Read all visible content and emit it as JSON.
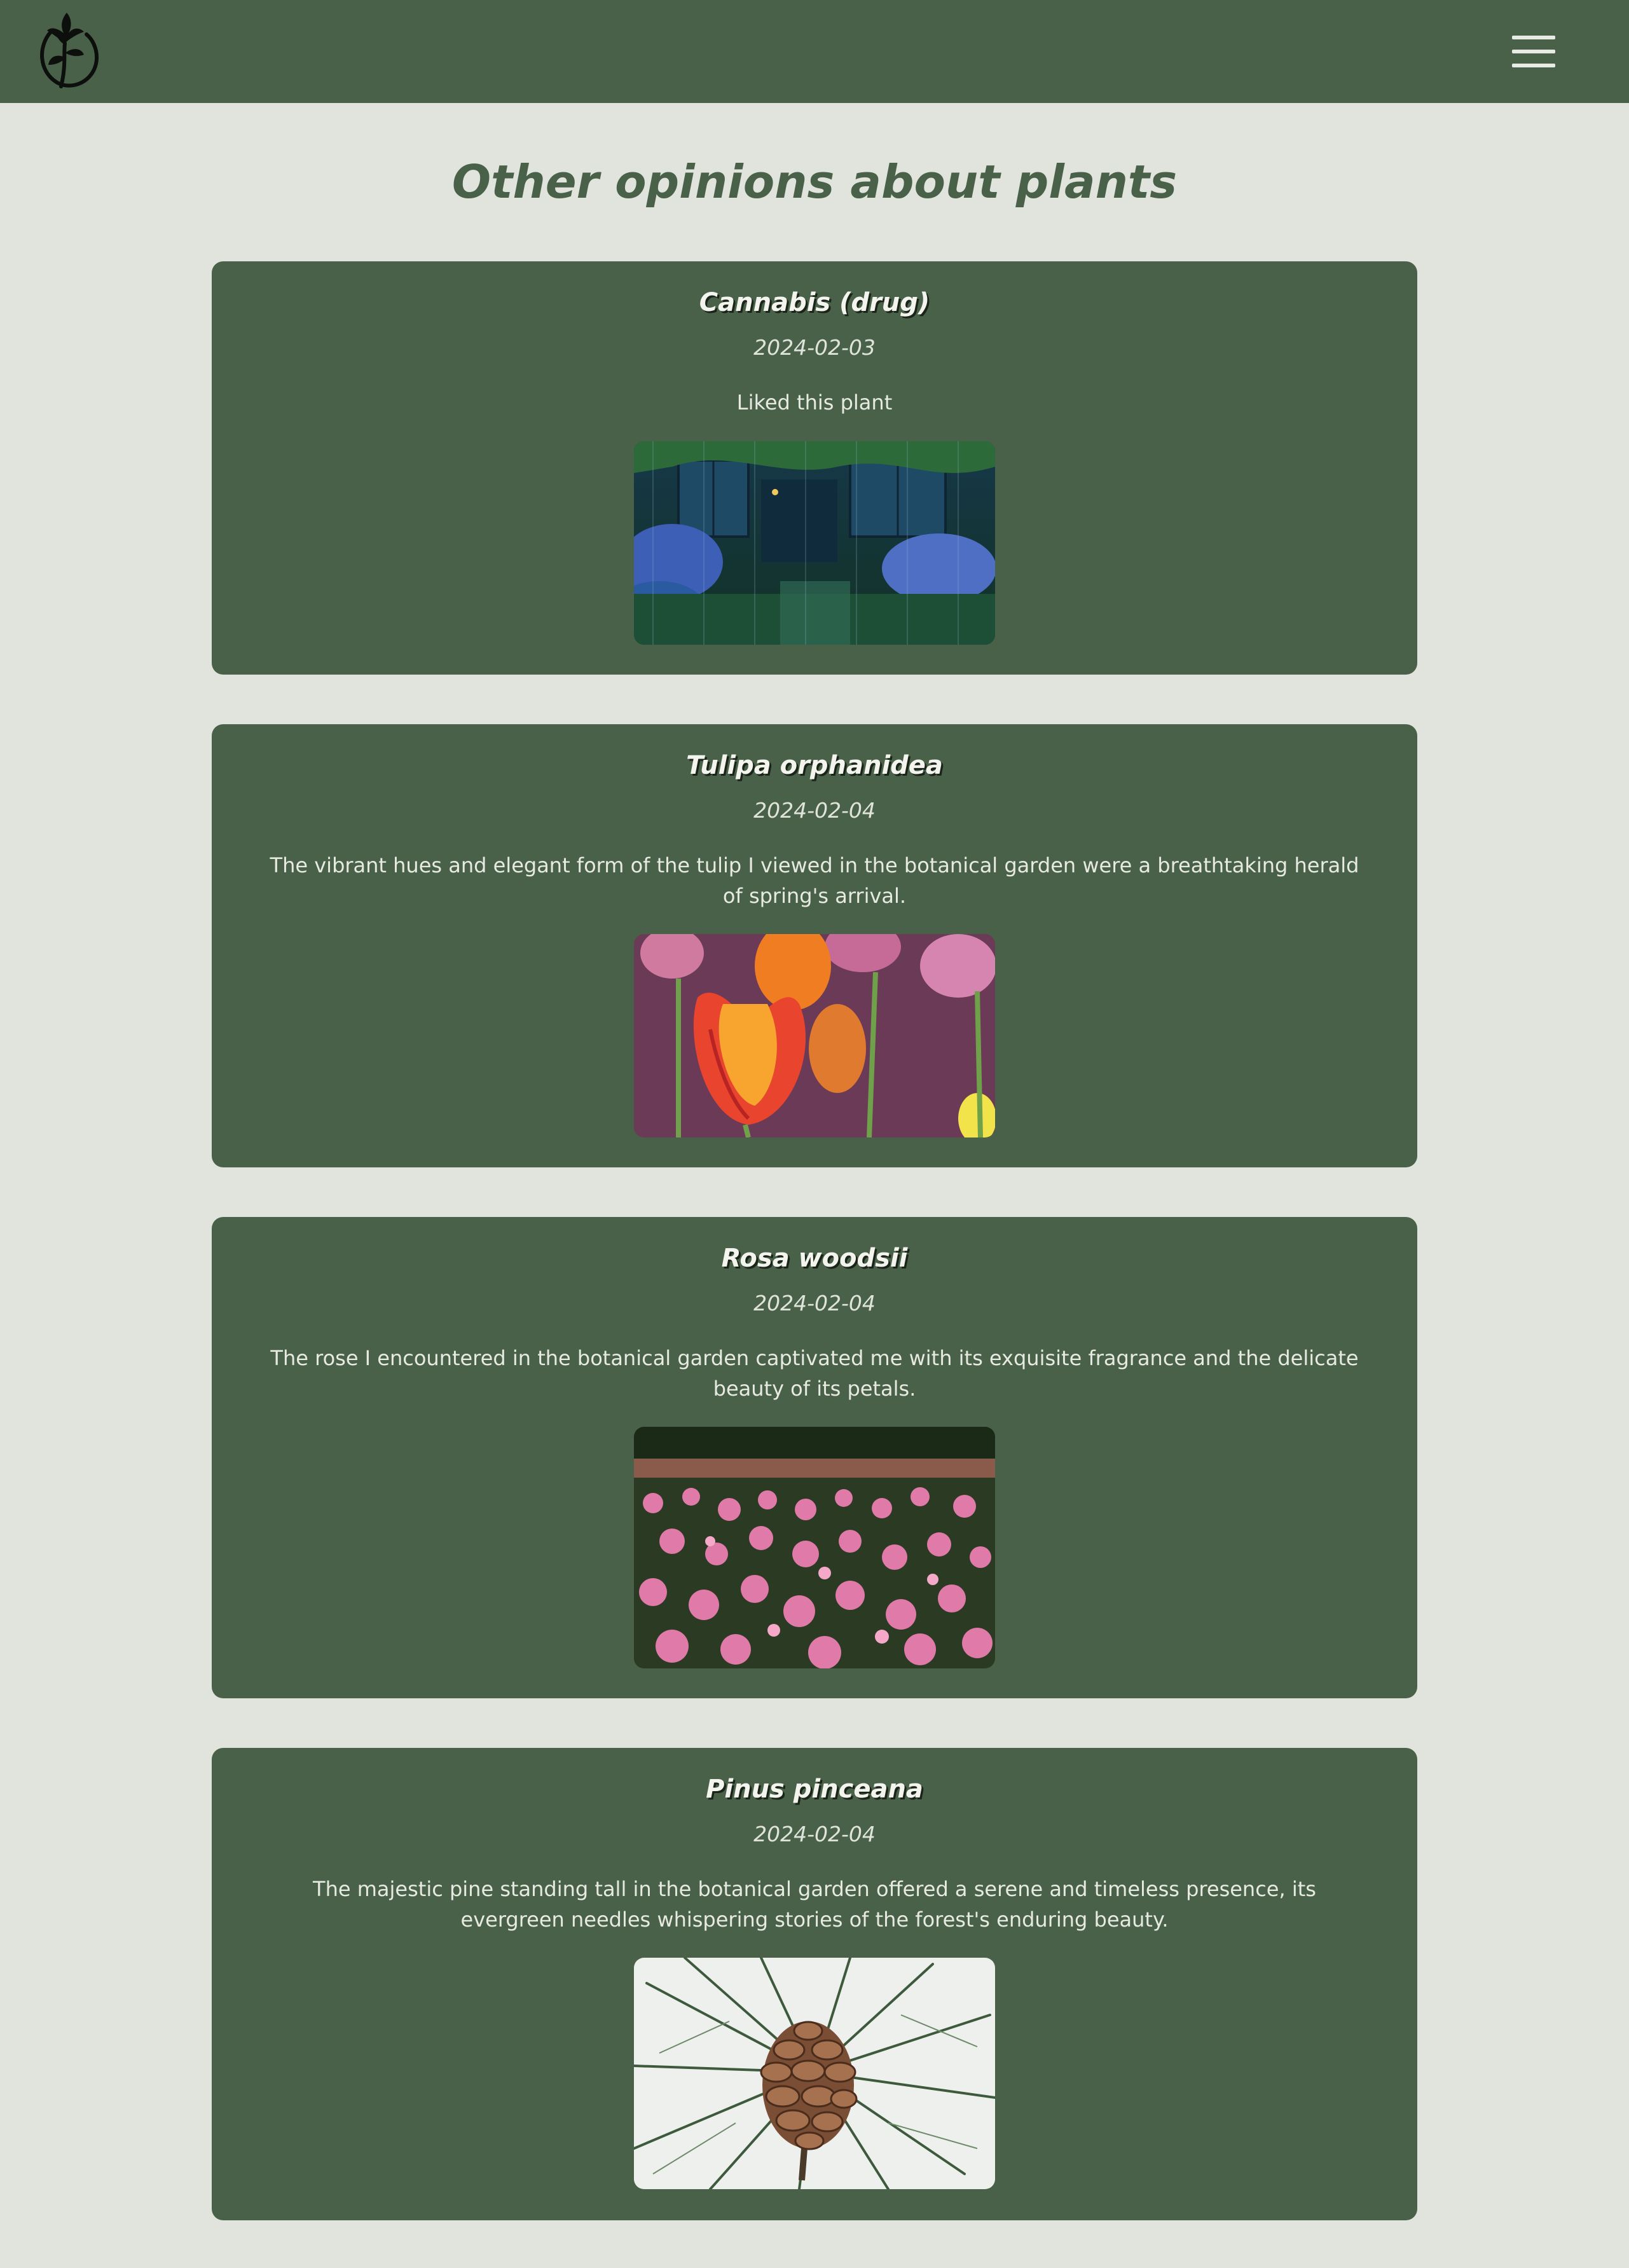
{
  "header": {
    "logo_icon": "lily-flower-logo-icon",
    "menu_icon": "hamburger-menu-icon"
  },
  "page": {
    "title": "Other opinions about plants"
  },
  "opinions": [
    {
      "name": "Cannabis (drug)",
      "date": "2024-02-03",
      "text": "Liked this plant",
      "image_icon": "rainy-garden-house-image"
    },
    {
      "name": "Tulipa orphanidea",
      "date": "2024-02-04",
      "text": "The vibrant hues and elegant form of the tulip I viewed in the botanical garden were a breathtaking herald of spring's arrival.",
      "image_icon": "tulips-image"
    },
    {
      "name": "Rosa woodsii",
      "date": "2024-02-04",
      "text": "The rose I encountered in the botanical garden captivated me with its exquisite fragrance and the delicate beauty of its petals.",
      "image_icon": "rose-field-image"
    },
    {
      "name": "Pinus pinceana",
      "date": "2024-02-04",
      "text": "The majestic pine standing tall in the botanical garden offered a serene and timeless presence, its evergreen needles whispering stories of the forest's enduring beauty.",
      "image_icon": "pine-cone-image"
    }
  ],
  "colors": {
    "header_bg": "#4a6149",
    "page_bg": "#e1e4dc",
    "card_bg": "#4a6149",
    "title": "#4a6149"
  }
}
